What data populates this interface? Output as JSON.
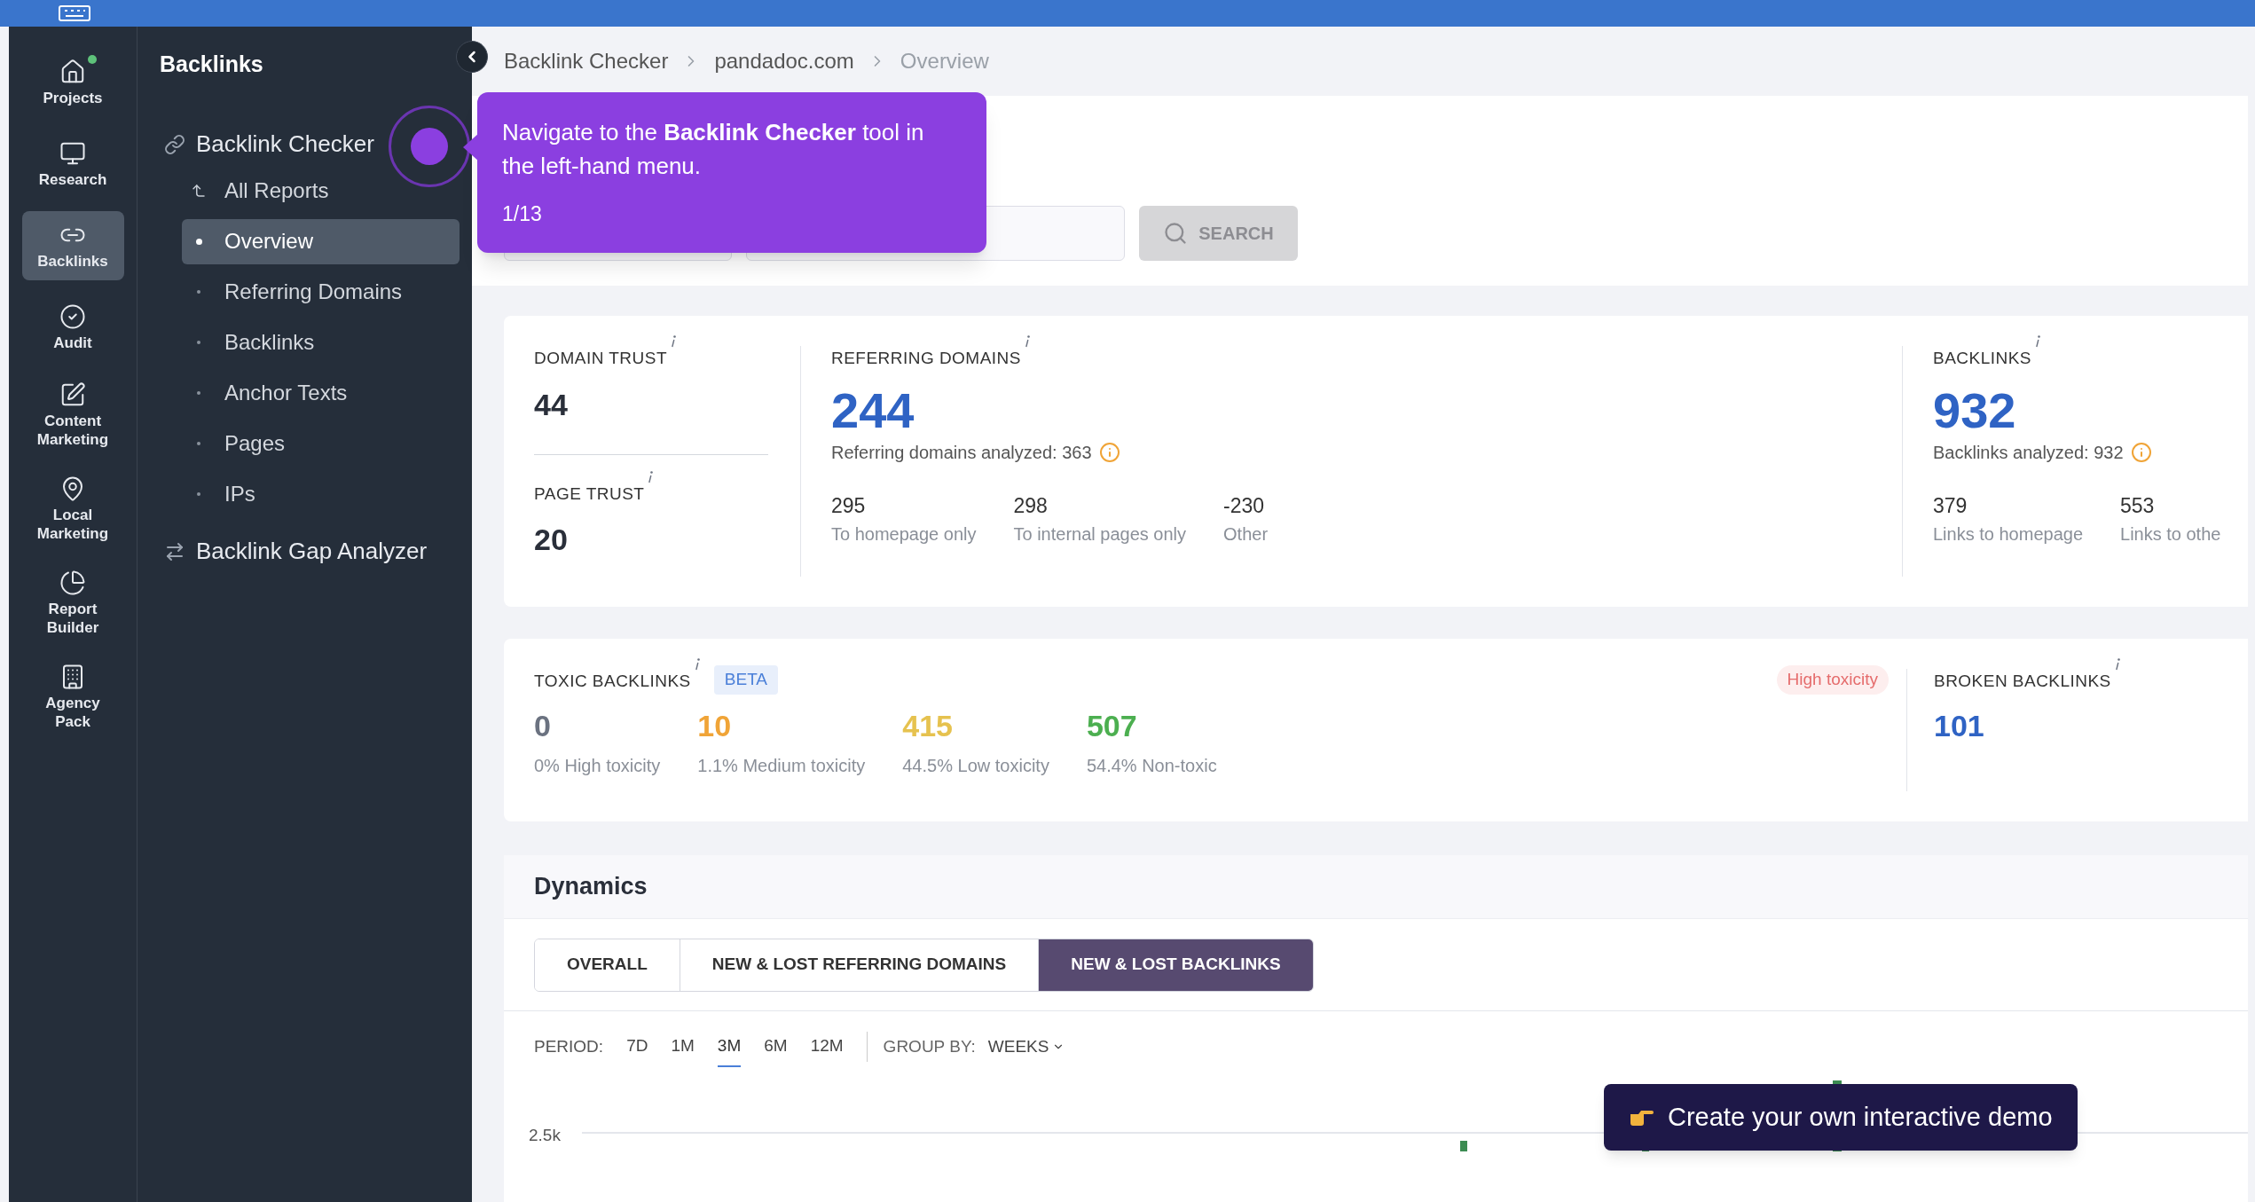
{
  "rail": [
    {
      "label": "Projects",
      "selected": false,
      "dot": true
    },
    {
      "label": "Research",
      "selected": false,
      "dot": false
    },
    {
      "label": "Backlinks",
      "selected": true,
      "dot": false
    },
    {
      "label": "Audit",
      "selected": false,
      "dot": false
    },
    {
      "label": "Content Marketing",
      "selected": false,
      "dot": false
    },
    {
      "label": "Local Marketing",
      "selected": false,
      "dot": false
    },
    {
      "label": "Report Builder",
      "selected": false,
      "dot": false
    },
    {
      "label": "Agency Pack",
      "selected": false,
      "dot": false
    }
  ],
  "sidebar": {
    "title": "Backlinks",
    "tools": [
      {
        "label": "Backlink Checker",
        "children": [
          {
            "label": "All Reports",
            "kind": "back",
            "selected": false
          },
          {
            "label": "Overview",
            "kind": "page",
            "selected": true
          },
          {
            "label": "Referring Domains",
            "kind": "page",
            "selected": false
          },
          {
            "label": "Backlinks",
            "kind": "page",
            "selected": false
          },
          {
            "label": "Anchor Texts",
            "kind": "page",
            "selected": false
          },
          {
            "label": "Pages",
            "kind": "page",
            "selected": false
          },
          {
            "label": "IPs",
            "kind": "page",
            "selected": false
          }
        ]
      },
      {
        "label": "Backlink Gap Analyzer"
      }
    ]
  },
  "breadcrumb": [
    "Backlink Checker",
    "pandadoc.com",
    "Overview"
  ],
  "search_button": "SEARCH",
  "stats": {
    "domain_trust": {
      "label": "DOMAIN TRUST",
      "value": "44"
    },
    "page_trust": {
      "label": "PAGE TRUST",
      "value": "20"
    },
    "referring_domains": {
      "label": "REFERRING DOMAINS",
      "value": "244",
      "note": "Referring domains analyzed: 363",
      "breakdown": [
        {
          "value": "295",
          "label": "To homepage only"
        },
        {
          "value": "298",
          "label": "To internal pages only"
        },
        {
          "value": "-230",
          "label": "Other"
        }
      ]
    },
    "backlinks": {
      "label": "BACKLINKS",
      "value": "932",
      "note": "Backlinks analyzed: 932",
      "breakdown": [
        {
          "value": "379",
          "label": "Links to homepage"
        },
        {
          "value": "553",
          "label": "Links to othe"
        }
      ]
    }
  },
  "toxic": {
    "label": "TOXIC BACKLINKS",
    "badge": "BETA",
    "tag": "High toxicity",
    "items": [
      {
        "value": "0",
        "label": "0% High toxicity",
        "color": "#6b7280"
      },
      {
        "value": "10",
        "label": "1.1% Medium toxicity",
        "color": "#f0a437"
      },
      {
        "value": "415",
        "label": "44.5% Low toxicity",
        "color": "#e6c24f"
      },
      {
        "value": "507",
        "label": "54.4% Non-toxic",
        "color": "#4caf50"
      }
    ]
  },
  "broken": {
    "label": "BROKEN BACKLINKS",
    "value": "101"
  },
  "dynamics": {
    "title": "Dynamics",
    "tabs": [
      {
        "label": "OVERALL",
        "selected": false
      },
      {
        "label": "NEW & LOST REFERRING DOMAINS",
        "selected": false
      },
      {
        "label": "NEW & LOST BACKLINKS",
        "selected": true
      }
    ],
    "period_label": "PERIOD:",
    "periods": [
      {
        "label": "7D",
        "selected": false
      },
      {
        "label": "1M",
        "selected": false
      },
      {
        "label": "3M",
        "selected": true
      },
      {
        "label": "6M",
        "selected": false
      },
      {
        "label": "12M",
        "selected": false
      }
    ],
    "group_by_label": "GROUP BY:",
    "group_by_value": "WEEKS",
    "chart_tick": "2.5k"
  },
  "tour": {
    "text": "Navigate to the **Backlink Checker** tool in the left-hand menu.",
    "step": "1/13"
  },
  "demo_button": "Create your own interactive demo"
}
